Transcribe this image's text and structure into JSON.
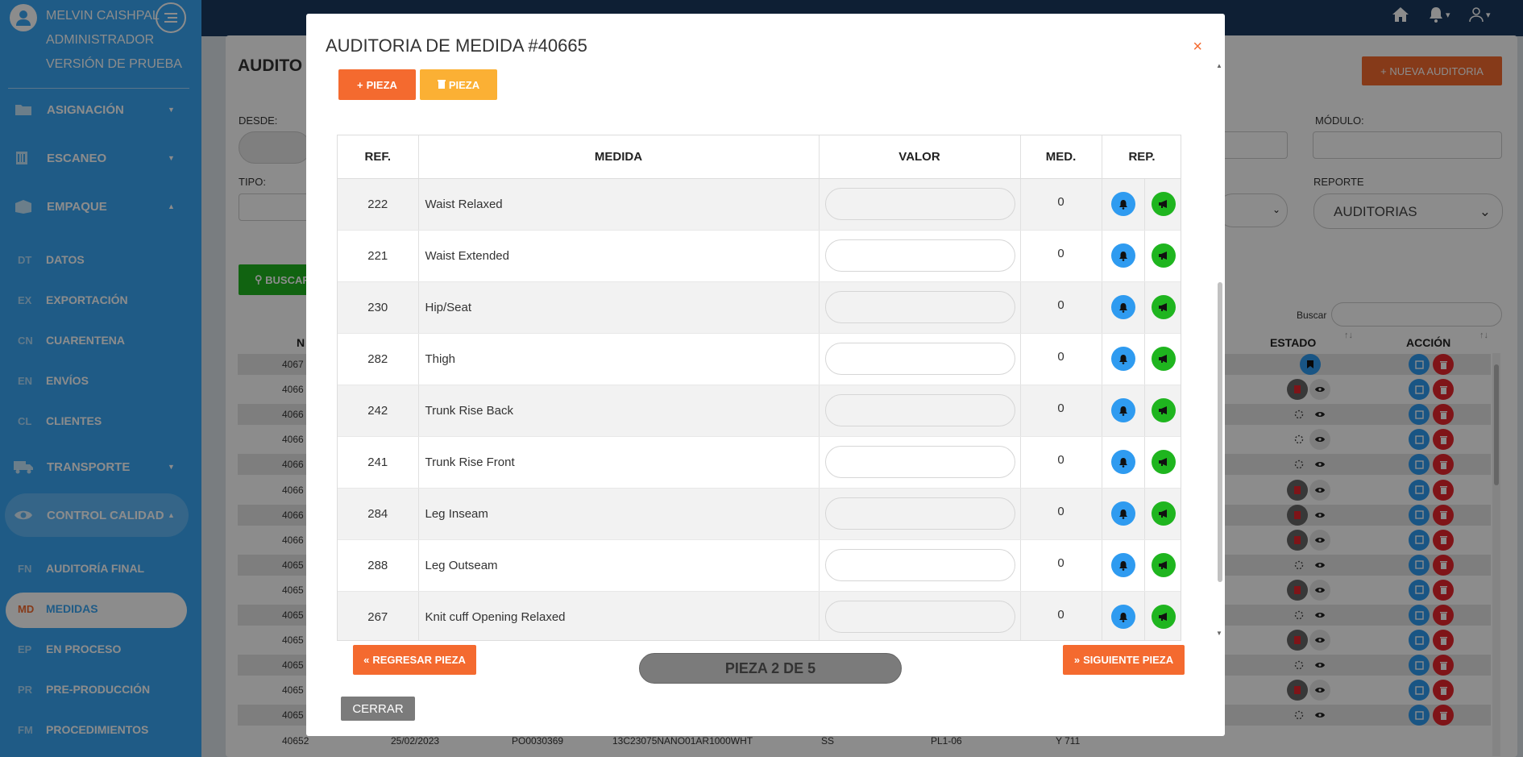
{
  "sidebar": {
    "user_name": "MELVIN CAISHPAL",
    "user_role": "ADMINISTRADOR",
    "version": "VERSIÓN DE PRUEBA",
    "main_items": [
      {
        "label": "ASIGNACIÓN",
        "icon": "folder-plus-icon"
      },
      {
        "label": "ESCANEO",
        "icon": "barcode-scanner-icon"
      },
      {
        "label": "EMPAQUE",
        "icon": "box-open-icon"
      }
    ],
    "empaque_items": [
      {
        "abbr": "DT",
        "label": "DATOS"
      },
      {
        "abbr": "EX",
        "label": "EXPORTACIÓN"
      },
      {
        "abbr": "CN",
        "label": "CUARENTENA"
      },
      {
        "abbr": "EN",
        "label": "ENVÍOS"
      },
      {
        "abbr": "CL",
        "label": "CLIENTES"
      }
    ],
    "transporte": {
      "label": "TRANSPORTE",
      "icon": "truck-icon"
    },
    "control_calidad": {
      "label": "CONTROL CALIDAD",
      "icon": "eye-icon"
    },
    "calidad_items": [
      {
        "abbr": "FN",
        "label": "AUDITORÍA FINAL"
      },
      {
        "abbr": "MD",
        "label": "MEDIDAS",
        "active": true
      },
      {
        "abbr": "EP",
        "label": "EN PROCESO"
      },
      {
        "abbr": "PR",
        "label": "PRE-PRODUCCIÓN"
      },
      {
        "abbr": "FM",
        "label": "PROCEDIMIENTOS"
      }
    ]
  },
  "topbar": {
    "icons": [
      "home-icon",
      "bell-icon",
      "user-icon"
    ],
    "accent": "#1a3a60"
  },
  "background": {
    "title": "AUDITO",
    "nueva_button": "NUEVA AUDITORIA",
    "desde_label": "DESDE:",
    "tipo_label": "TIPO:",
    "modulo_label": "MÓDULO:",
    "reporte_label": "REPORTE",
    "reporte_value": "AUDITORIAS",
    "buscar_button": "BUSCAR",
    "search_label": "Buscar",
    "col_n": "N",
    "col_estado": "ESTADO",
    "col_accion": "ACCIÓN",
    "row_ids": [
      "4067",
      "4066",
      "4066",
      "4066",
      "4066",
      "4066",
      "4066",
      "4066",
      "4065",
      "4065",
      "4065",
      "4065",
      "4065",
      "4065",
      "4065"
    ],
    "last_row": {
      "id": "40652",
      "date": "25/02/2023",
      "po": "PO0030369",
      "style": "13C23075NANO01AR1000WHT",
      "size": "SS",
      "line": "PL1-06",
      "module": "Y 711"
    }
  },
  "modal": {
    "title": "AUDITORIA DE MEDIDA #40665",
    "close": "×",
    "add_piece": "PIEZA",
    "delete_piece": "PIEZA",
    "columns": {
      "ref": "REF.",
      "medida": "MEDIDA",
      "valor": "VALOR",
      "med": "MED.",
      "rep": "REP."
    },
    "rows": [
      {
        "ref": "222",
        "medida": "Waist Relaxed",
        "med": "0"
      },
      {
        "ref": "221",
        "medida": "Waist Extended",
        "med": "0"
      },
      {
        "ref": "230",
        "medida": "Hip/Seat",
        "med": "0"
      },
      {
        "ref": "282",
        "medida": "Thigh",
        "med": "0"
      },
      {
        "ref": "242",
        "medida": "Trunk Rise Back",
        "med": "0"
      },
      {
        "ref": "241",
        "medida": "Trunk Rise Front",
        "med": "0"
      },
      {
        "ref": "284",
        "medida": "Leg Inseam",
        "med": "0"
      },
      {
        "ref": "288",
        "medida": "Leg Outseam",
        "med": "0"
      },
      {
        "ref": "267",
        "medida": "Knit cuff Opening Relaxed",
        "med": "0"
      }
    ],
    "prev_button": "REGRESAR PIEZA",
    "piece_indicator": "PIEZA 2 DE 5",
    "next_button": "SIGUIENTE PIEZA",
    "close_button": "CERRAR"
  },
  "colors": {
    "sidebar": "#3aa7f5",
    "orange": "#f46a2f",
    "yellow": "#fbb034",
    "green": "#1fb51f",
    "blue": "#2f9bf0",
    "red": "#e8262c"
  }
}
